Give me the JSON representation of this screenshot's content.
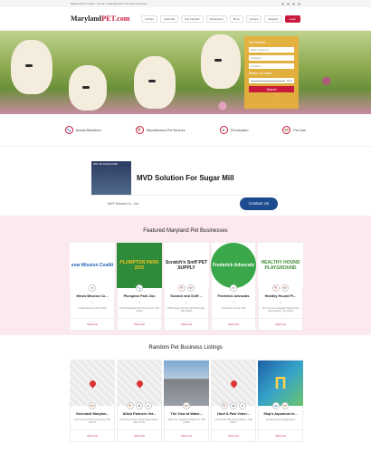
{
  "topbar": {
    "welcome": "Maryland Pet Guide - Guide to Maryland Pet Services & Events"
  },
  "header": {
    "logo_main": "Maryland",
    "logo_pet": "PET",
    "logo_suffix": ".com",
    "nav": [
      "Articles",
      "Calendar",
      "Get Familiar",
      "Adventures",
      "More",
      "Groups",
      "Register"
    ],
    "login": "Login"
  },
  "hero": {
    "search": {
      "title": "Get Started",
      "keyword_placeholder": "Enter Keyword",
      "category_placeholder": "Category",
      "location_placeholder": "Location",
      "radius_label": "Radius (in miles)",
      "radius_value": "35 mi",
      "button": "Search"
    }
  },
  "categories": [
    {
      "icon": "animal-icon",
      "label": "Animal Attractions"
    },
    {
      "icon": "paw-icon",
      "label": "Miscellaneous Pet Services"
    },
    {
      "icon": "heart-paw-icon",
      "label": "Pet Adoption"
    },
    {
      "icon": "dog-icon",
      "label": "Pet Care"
    }
  ],
  "ad": {
    "image_text": "INVT MV SOLAR PUMP",
    "title": "MVD Solution For Sugar Mill",
    "company": "INVT Electric Co., Ltd.",
    "button": "Contact Us"
  },
  "featured": {
    "title": "Featured Maryland Pet Businesses",
    "items": [
      {
        "name": "Meow Mission Co...",
        "image_text": "eow Mission Coaliti",
        "image_color": "#ffffff",
        "text_color": "#1f63b5",
        "rating": "★",
        "address": "Gaithersburg, MD 21705",
        "visit": "Visit now"
      },
      {
        "name": "Plumpton Park Zoo",
        "image_text": "PLUMPTON PARK ZOO",
        "image_color": "#2e8b3a",
        "text_color": "#f6c21f",
        "rating": "★",
        "address": "1416 Telegraph Rd Rising Sun, MD 21911",
        "visit": "Visit now"
      },
      {
        "name": "Scratch and Sniff ...",
        "image_text": "Scratch'n Sniff PET SUPPLY",
        "image_color": "#ffffff",
        "text_color": "#222222",
        "rating": "★",
        "address": "2505 Eager Rd Ste 115 Pikesville, MD 21201",
        "visit": "Visit now"
      },
      {
        "name": "Frederick Advocats",
        "image_text": "Frederick Advocats",
        "image_color": "#3aa84a",
        "text_color": "#ffffff",
        "rating": "★",
        "address": "Frederick County, MD",
        "visit": "Visit now"
      },
      {
        "name": "Healthy Hound Pl...",
        "image_text": "HEALTHY HOUND PLAYGROUND",
        "image_color": "#ffffff",
        "text_color": "#3b8a30",
        "rating": "★",
        "address": "15 N Commonwealth Plaza Suite 100 Sterling, VA 20166",
        "visit": "Visit now"
      }
    ]
  },
  "random": {
    "title": "Random Pet Business Listings",
    "items": [
      {
        "name": "Greenbelt Marylan...",
        "address": "123 Crescent Rd Greenbelt, MD 20770",
        "visit": "Visit now"
      },
      {
        "name": "Allied Partners Vet...",
        "address": "6750 Old Route Road Hagerstown, MD 21742",
        "visit": "Visit now"
      },
      {
        "name": "The View at Water...",
        "address": "1100 Key Highway Baltimore, MD 21230",
        "visit": "Visit now"
      },
      {
        "name": "Hoof & Paw Veteri...",
        "address": "123 South Mill Road Fallston, MD 21047",
        "visit": "Visit now"
      },
      {
        "name": "Skip's Aquarium In...",
        "address": "Sterling Road Hagerstown",
        "visit": "Visit now"
      }
    ]
  }
}
